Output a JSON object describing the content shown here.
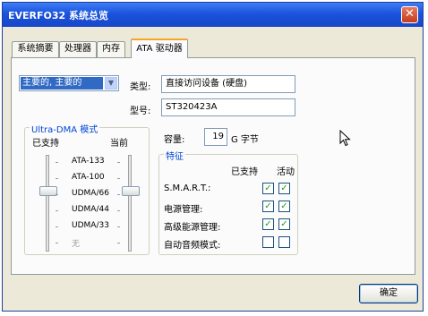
{
  "window": {
    "title": "EVERFO32 系统总览",
    "close_symbol": "✕"
  },
  "tabs": [
    {
      "label": "系统摘要"
    },
    {
      "label": "处理器"
    },
    {
      "label": "内存"
    },
    {
      "label": "ATA 驱动器",
      "active": true
    }
  ],
  "device_select": {
    "value": "主要的, 主要的"
  },
  "info": {
    "type_label": "类型:",
    "type_value": "直接访问设备 (硬盘)",
    "model_label": "型号:",
    "model_value": "ST320423A",
    "capacity_label": "容量:",
    "capacity_value": "19",
    "capacity_unit": "G 字节"
  },
  "udma": {
    "title": "Ultra-DMA 模式",
    "supported_header": "已支持",
    "current_header": "当前",
    "modes": [
      {
        "label": "ATA-133",
        "dim": false
      },
      {
        "label": "ATA-100",
        "dim": false
      },
      {
        "label": "UDMA/66",
        "dim": false
      },
      {
        "label": "UDMA/44",
        "dim": false
      },
      {
        "label": "UDMA/33",
        "dim": false
      },
      {
        "label": "无",
        "dim": true
      }
    ],
    "supported_level": "UDMA/66",
    "current_level": "UDMA/66"
  },
  "features": {
    "title": "特征",
    "supported_header": "已支持",
    "active_header": "活动",
    "rows": [
      {
        "label": "S.M.A.R.T.:",
        "supported": true,
        "active": true
      },
      {
        "label": "电源管理:",
        "supported": true,
        "active": true
      },
      {
        "label": "高级能源管理:",
        "supported": true,
        "active": true
      },
      {
        "label": "自动音频模式:",
        "supported": false,
        "active": false
      }
    ],
    "check_symbol": "✓"
  },
  "buttons": {
    "ok": "确定"
  },
  "colors": {
    "titlebar": "#1a53dd",
    "selection": "#316ac5",
    "group_title": "#0046d5",
    "check": "#21a121"
  }
}
